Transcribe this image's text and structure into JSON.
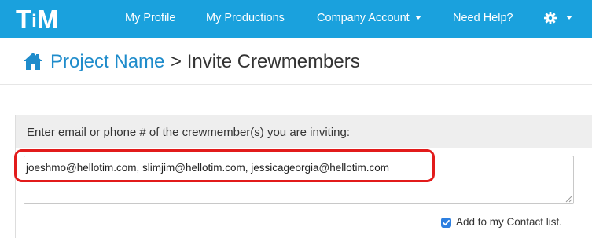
{
  "brand": {
    "logo_text_left": "T",
    "logo_text_mid": "i",
    "logo_text_right": "M"
  },
  "nav": {
    "my_profile": "My Profile",
    "my_productions": "My Productions",
    "company_account": "Company Account",
    "need_help": "Need Help?",
    "settings_icon": "gear-icon"
  },
  "breadcrumb": {
    "project": "Project Name",
    "separator": ">",
    "page": "Invite Crewmembers"
  },
  "invite": {
    "instruction": "Enter email or phone # of the crewmember(s) you are inviting:",
    "emails_value": "joeshmo@hellotim.com, slimjim@hellotim.com, jessicageorgia@hellotim.com",
    "add_to_contacts_label": "Add to my Contact list.",
    "add_to_contacts_checked": true
  },
  "colors": {
    "navbar": "#1aa1dd",
    "link": "#1f8ccb",
    "highlight": "#e21b1b",
    "checkbox": "#2d7fe0"
  }
}
